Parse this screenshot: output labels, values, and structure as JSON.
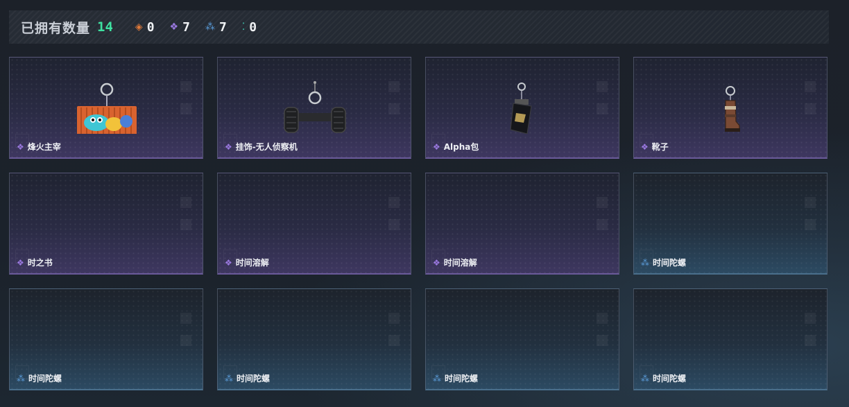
{
  "header": {
    "owned_label": "已拥有数量",
    "owned_count": "14",
    "stats": [
      {
        "icon": "orange-diamond-icon",
        "glyph": "◈",
        "color": "#e07a3a",
        "value": "0"
      },
      {
        "icon": "purple-diamond-cluster-icon",
        "glyph": "❖",
        "color": "#9a78e0",
        "value": "7"
      },
      {
        "icon": "blue-triangle-cluster-icon",
        "glyph": "⁂",
        "color": "#5a9bd8",
        "value": "7"
      },
      {
        "icon": "teal-dots-icon",
        "glyph": "⁚",
        "color": "#3ed1b8",
        "value": "0"
      }
    ]
  },
  "items": [
    {
      "name": "烽火主宰",
      "rarity": "purple",
      "art": "container-keychain"
    },
    {
      "name": "挂饰-无人侦察机",
      "rarity": "purple",
      "art": "drone-keychain"
    },
    {
      "name": "Alpha包",
      "rarity": "purple",
      "art": "bag-keychain"
    },
    {
      "name": "靴子",
      "rarity": "purple",
      "art": "boot-keychain"
    },
    {
      "name": "时之书",
      "rarity": "purple",
      "art": ""
    },
    {
      "name": "时间溶解",
      "rarity": "purple",
      "art": ""
    },
    {
      "name": "时间溶解",
      "rarity": "purple",
      "art": ""
    },
    {
      "name": "时间陀螺",
      "rarity": "blue",
      "art": ""
    },
    {
      "name": "时间陀螺",
      "rarity": "blue",
      "art": ""
    },
    {
      "name": "时间陀螺",
      "rarity": "blue",
      "art": ""
    },
    {
      "name": "时间陀螺",
      "rarity": "blue",
      "art": ""
    },
    {
      "name": "时间陀螺",
      "rarity": "blue",
      "art": ""
    }
  ]
}
